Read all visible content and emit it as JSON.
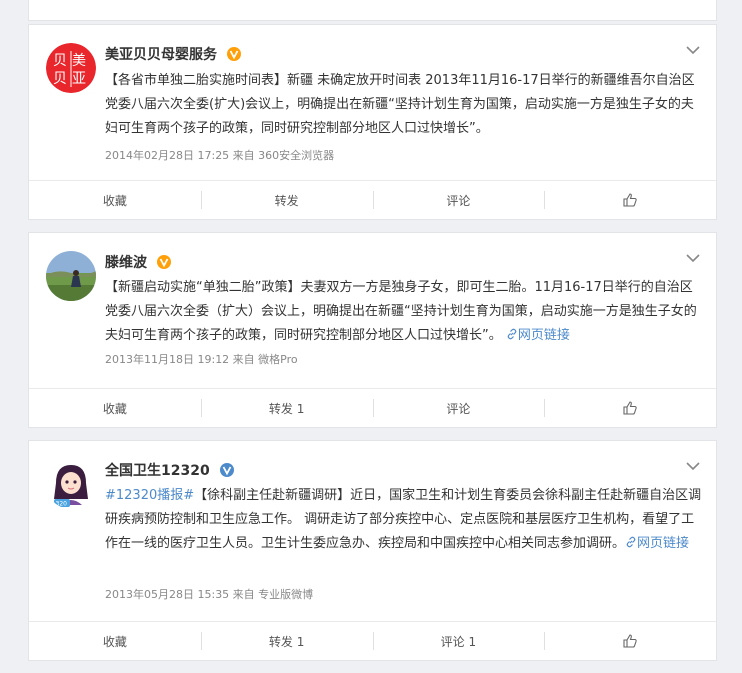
{
  "feed": {
    "posts": [
      {
        "author": "美亚贝贝母婴服务",
        "verified": true,
        "avatar": "meiya-logo",
        "content_prefix": "【各省市单独二胎实施时间表】新疆 未确定放开时间表 2013年11月16-17日举行的新疆维吾尔自治区党委八届六次全委(扩大)会议上，明确提出在新疆“坚持计划生育为国策，启动实施一方是独生子女的夫妇可生育两个孩子的政策，同时研究控制部分地区人口过快增长”。",
        "meta": "2014年02月28日 17:25  来自 360安全浏览器",
        "actions": {
          "favorite": "收藏",
          "repost": "转发",
          "comment": "评论"
        }
      },
      {
        "author": "滕维波",
        "verified": true,
        "avatar": "outdoor-photo",
        "content_prefix": "【新疆启动实施“单独二胎”政策】夫妻双方一方是独身子女，即可生二胎。11月16-17日举行的自治区党委八届六次全委（扩大）会议上，明确提出在新疆“坚持计划生育为国策，启动实施一方是独生子女的夫妇可生育两个孩子的政策，同时研究控制部分地区人口过快增长”。",
        "weblink": "网页链接",
        "meta": "2013年11月18日 19:12  来自 微格Pro",
        "actions": {
          "favorite": "收藏",
          "repost": "转发 1",
          "comment": "评论"
        }
      },
      {
        "author": "全国卫生12320",
        "verified": true,
        "avatar": "cartoon-nurse",
        "topic": "#12320播报#",
        "content_prefix": "【徐科副主任赴新疆调研】近日，国家卫生和计划生育委员会徐科副主任赴新疆自治区调研疾病预防控制和卫生应急工作。 调研走访了部分疾控中心、定点医院和基层医疗卫生机构，看望了工作在一线的医疗卫生人员。卫生计生委应急办、疾控局和中国疾控中心相关同志参加调研。",
        "weblink": "网页链接",
        "meta": "2013年05月28日 15:35  来自 专业版微博",
        "actions": {
          "favorite": "收藏",
          "repost": "转发 1",
          "comment": "评论 1"
        }
      }
    ]
  },
  "colors": {
    "verified": "#ffa00a",
    "link": "#4d8acb"
  }
}
